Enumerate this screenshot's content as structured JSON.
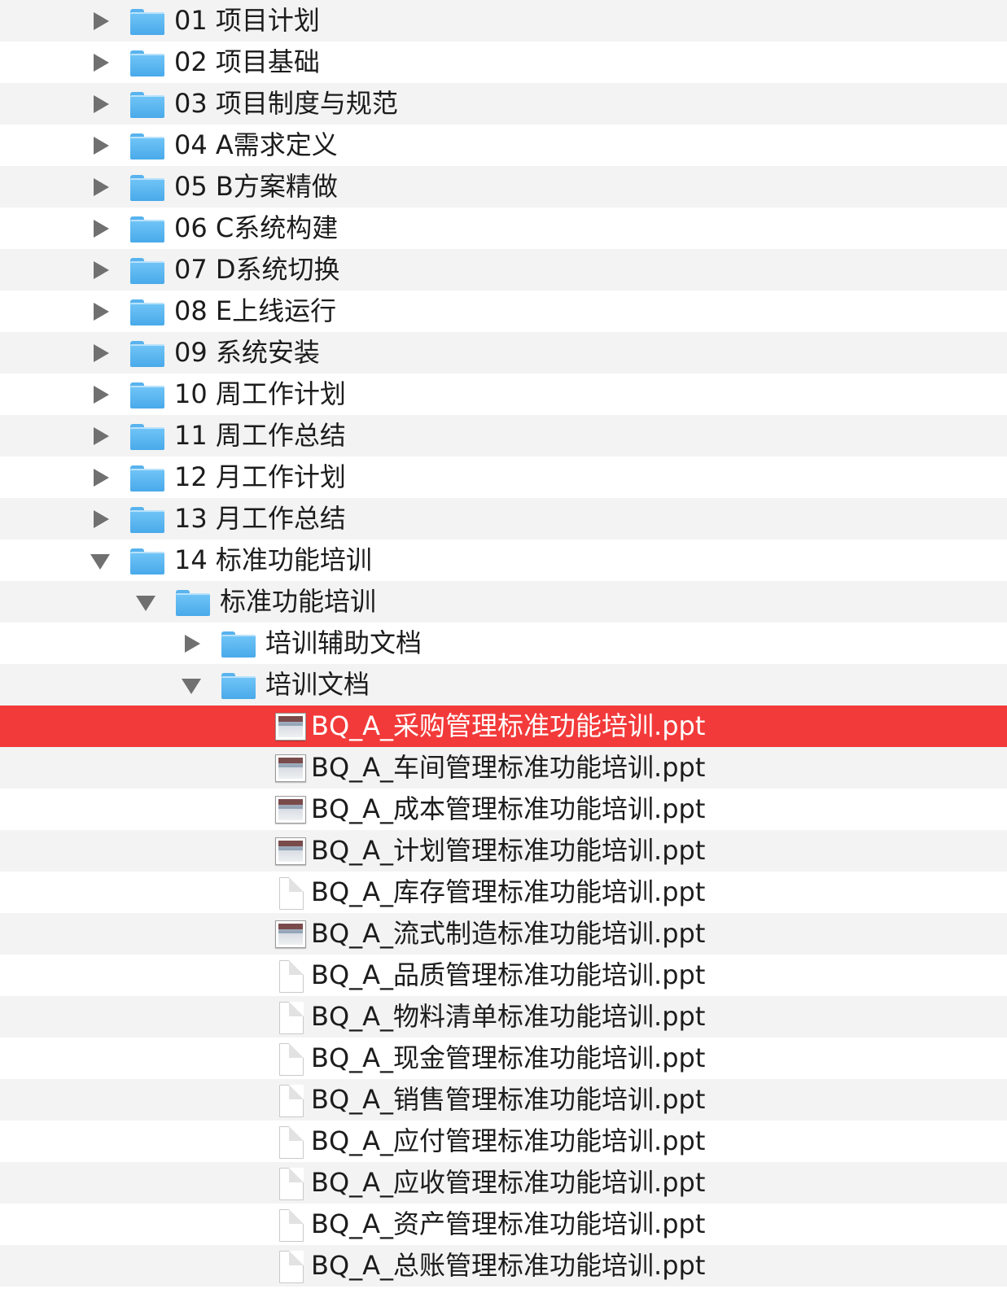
{
  "file_browser": {
    "items": [
      {
        "type": "folder",
        "label": "01 项目计划",
        "expanded": false
      },
      {
        "type": "folder",
        "label": "02 项目基础",
        "expanded": false
      },
      {
        "type": "folder",
        "label": "03 项目制度与规范",
        "expanded": false
      },
      {
        "type": "folder",
        "label": "04 A需求定义",
        "expanded": false
      },
      {
        "type": "folder",
        "label": "05 B方案精做",
        "expanded": false
      },
      {
        "type": "folder",
        "label": "06 C系统构建",
        "expanded": false
      },
      {
        "type": "folder",
        "label": "07 D系统切换",
        "expanded": false
      },
      {
        "type": "folder",
        "label": "08 E上线运行",
        "expanded": false
      },
      {
        "type": "folder",
        "label": "09 系统安装",
        "expanded": false
      },
      {
        "type": "folder",
        "label": "10 周工作计划",
        "expanded": false
      },
      {
        "type": "folder",
        "label": "11 周工作总结",
        "expanded": false
      },
      {
        "type": "folder",
        "label": "12 月工作计划",
        "expanded": false
      },
      {
        "type": "folder",
        "label": "13 月工作总结",
        "expanded": false
      },
      {
        "type": "folder",
        "label": "14 标准功能培训",
        "expanded": true
      },
      {
        "type": "folder",
        "label": "标准功能培训",
        "expanded": true
      },
      {
        "type": "folder",
        "label": "培训辅助文档",
        "expanded": false
      },
      {
        "type": "folder",
        "label": "培训文档",
        "expanded": true
      },
      {
        "type": "file",
        "label": "BQ_A_采购管理标准功能培训.ppt",
        "icon": "slide-thumbnail-icon",
        "selected": true
      },
      {
        "type": "file",
        "label": "BQ_A_车间管理标准功能培训.ppt",
        "icon": "slide-thumbnail-icon"
      },
      {
        "type": "file",
        "label": "BQ_A_成本管理标准功能培训.ppt",
        "icon": "slide-thumbnail-icon"
      },
      {
        "type": "file",
        "label": "BQ_A_计划管理标准功能培训.ppt",
        "icon": "slide-thumbnail-icon"
      },
      {
        "type": "file",
        "label": "BQ_A_库存管理标准功能培训.ppt",
        "icon": "blank-document-icon"
      },
      {
        "type": "file",
        "label": "BQ_A_流式制造标准功能培训.ppt",
        "icon": "slide-thumbnail-icon"
      },
      {
        "type": "file",
        "label": "BQ_A_品质管理标准功能培训.ppt",
        "icon": "blank-document-icon"
      },
      {
        "type": "file",
        "label": "BQ_A_物料清单标准功能培训.ppt",
        "icon": "blank-document-icon"
      },
      {
        "type": "file",
        "label": "BQ_A_现金管理标准功能培训.ppt",
        "icon": "blank-document-icon"
      },
      {
        "type": "file",
        "label": "BQ_A_销售管理标准功能培训.ppt",
        "icon": "blank-document-icon"
      },
      {
        "type": "file",
        "label": "BQ_A_应付管理标准功能培训.ppt",
        "icon": "blank-document-icon"
      },
      {
        "type": "file",
        "label": "BQ_A_应收管理标准功能培训.ppt",
        "icon": "blank-document-icon"
      },
      {
        "type": "file",
        "label": "BQ_A_资产管理标准功能培训.ppt",
        "icon": "blank-document-icon"
      },
      {
        "type": "file",
        "label": "BQ_A_总账管理标准功能培训.ppt",
        "icon": "blank-document-icon"
      }
    ]
  },
  "colors": {
    "selection": "#f33a3a",
    "folder": "#5bb7f0",
    "stripe": "#f3f3f3"
  }
}
